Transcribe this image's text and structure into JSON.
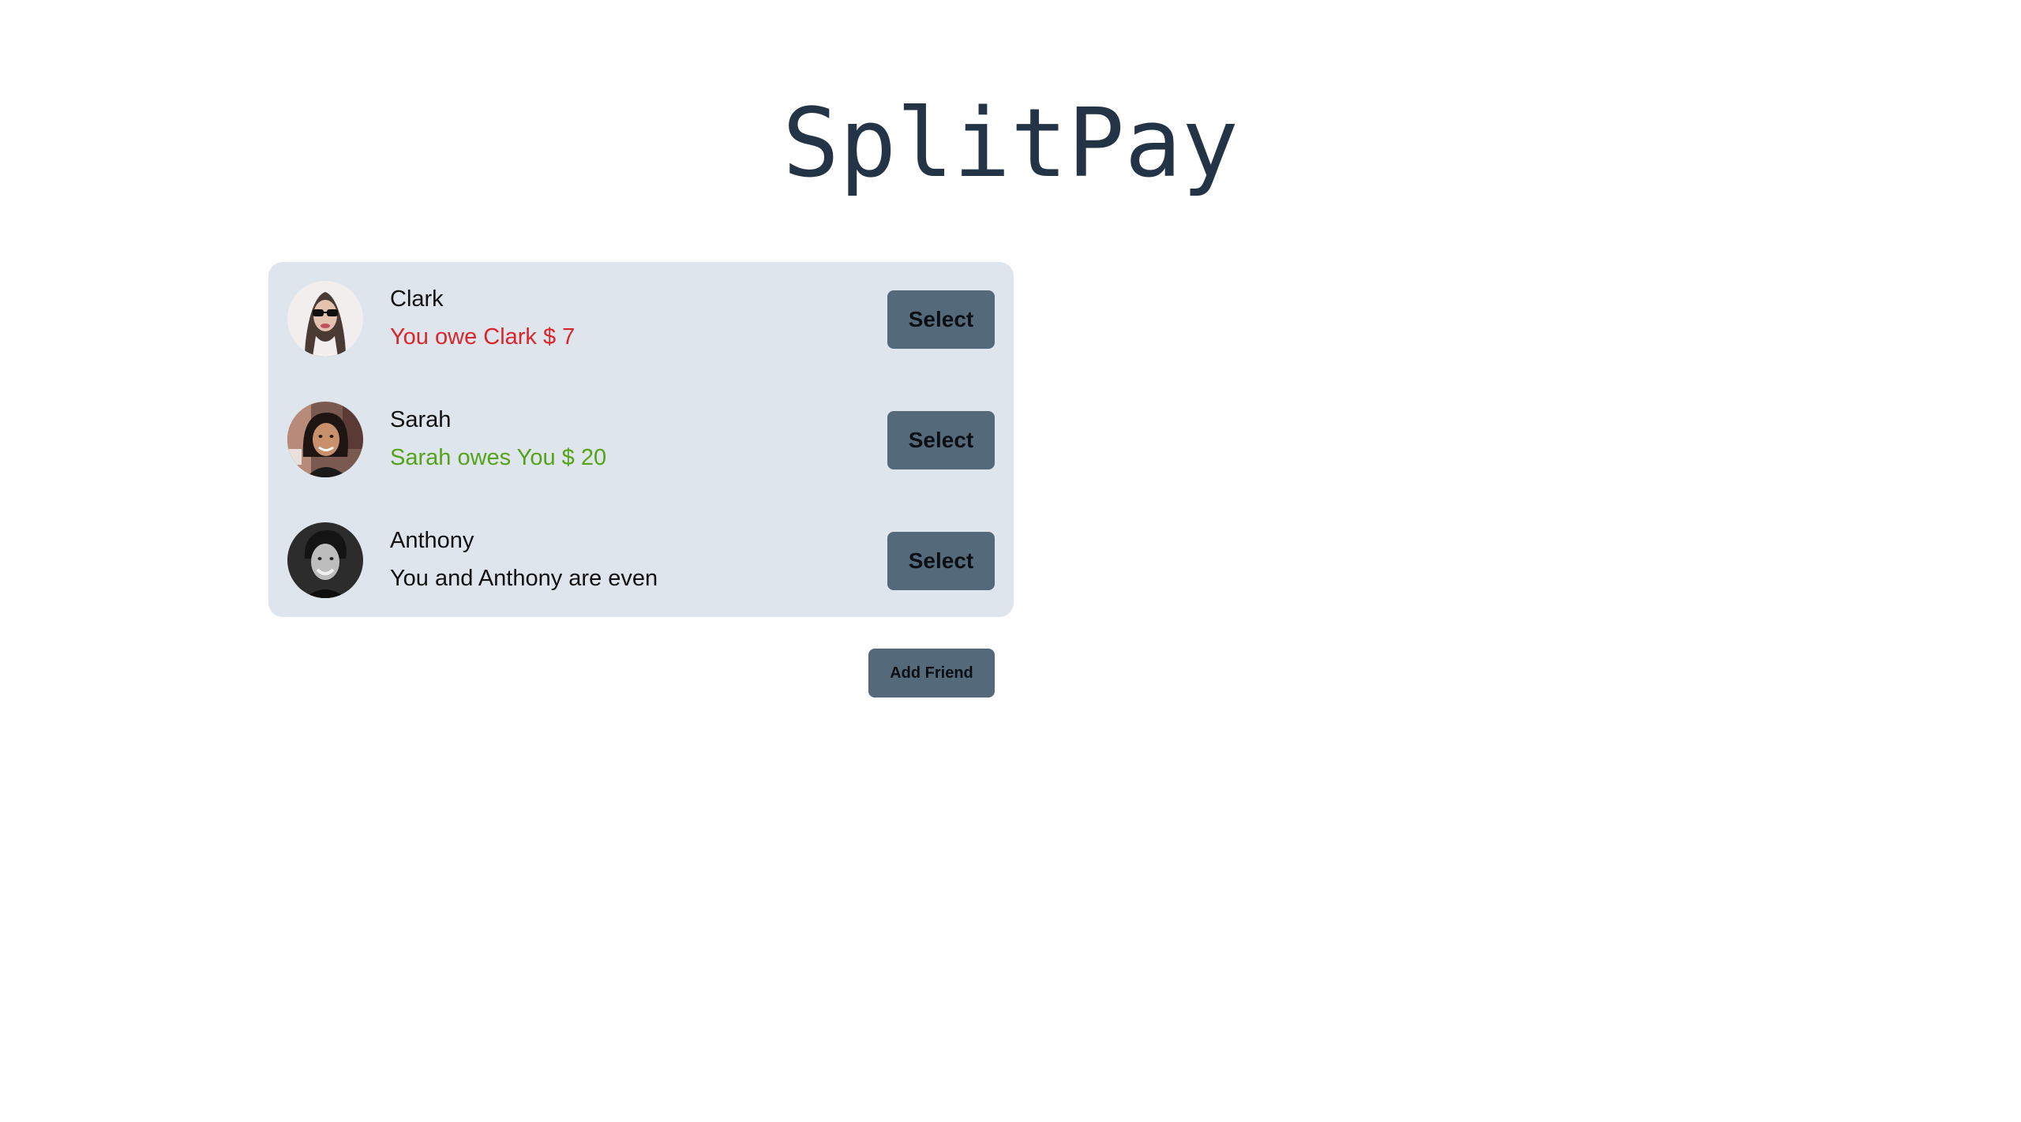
{
  "app": {
    "title": "SplitPay"
  },
  "friends": [
    {
      "name": "Clark",
      "status": "You owe Clark $ 7",
      "status_color": "#d9262b",
      "select_label": "Select",
      "avatar_icon": "avatar-photo"
    },
    {
      "name": "Sarah",
      "status": "Sarah owes You $ 20",
      "status_color": "#54a319",
      "select_label": "Select",
      "avatar_icon": "avatar-photo"
    },
    {
      "name": "Anthony",
      "status": "You and Anthony are even",
      "status_color": "#111111",
      "select_label": "Select",
      "avatar_icon": "avatar-photo"
    }
  ],
  "actions": {
    "add_friend_label": "Add Friend"
  },
  "colors": {
    "title": "#243447",
    "panel_bg": "#dee5ec",
    "button_bg": "#546a7b",
    "owe_red": "#d9262b",
    "owed_green": "#54a319"
  }
}
